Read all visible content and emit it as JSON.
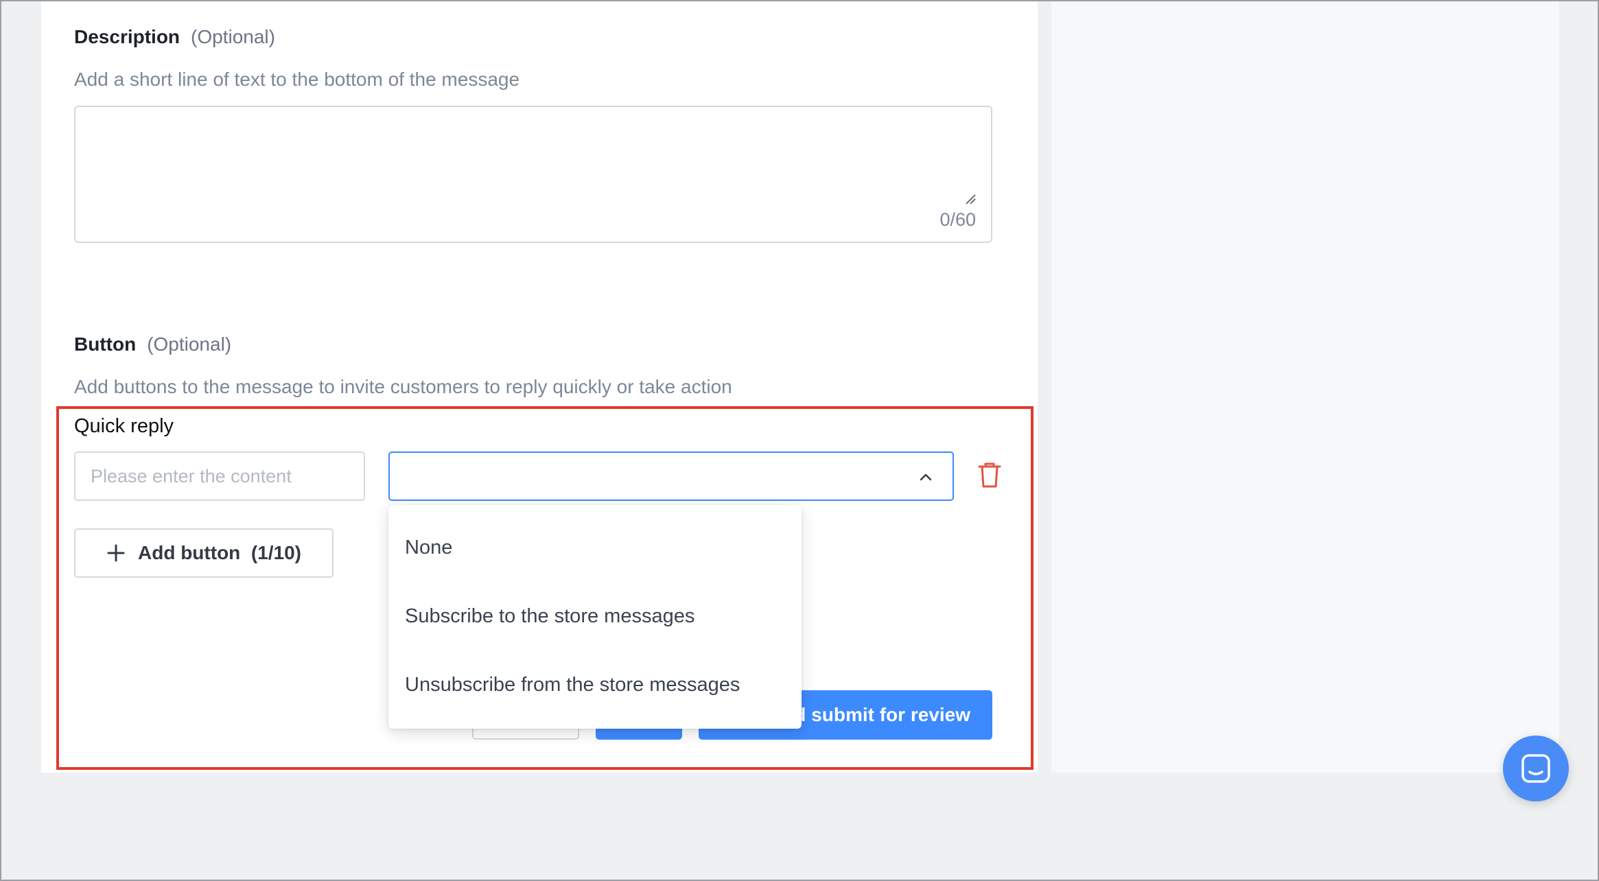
{
  "description_section": {
    "title": "Description",
    "optional": "(Optional)",
    "hint": "Add a short line of text to the bottom of the message",
    "char_count": "0/60"
  },
  "button_section": {
    "title": "Button",
    "optional": "(Optional)",
    "hint": "Add buttons to the message to invite customers to reply quickly or take action"
  },
  "quick_reply": {
    "label": "Quick reply",
    "content_placeholder": "Please enter the content",
    "action_select_value": "",
    "options": [
      "None",
      "Subscribe to the store messages",
      "Unsubscribe from the store messages"
    ],
    "add_button_label": "Add button  (1/10)"
  },
  "footer_actions": {
    "submit_label_visible": "d submit for review"
  },
  "colors": {
    "primary": "#3d8aff",
    "highlight_border": "#e03a2e",
    "delete_icon": "#e5533f"
  },
  "icons": {
    "chevron": "chevron-up-icon",
    "delete": "trash-icon",
    "add": "plus-icon",
    "chat": "chat-icon"
  }
}
